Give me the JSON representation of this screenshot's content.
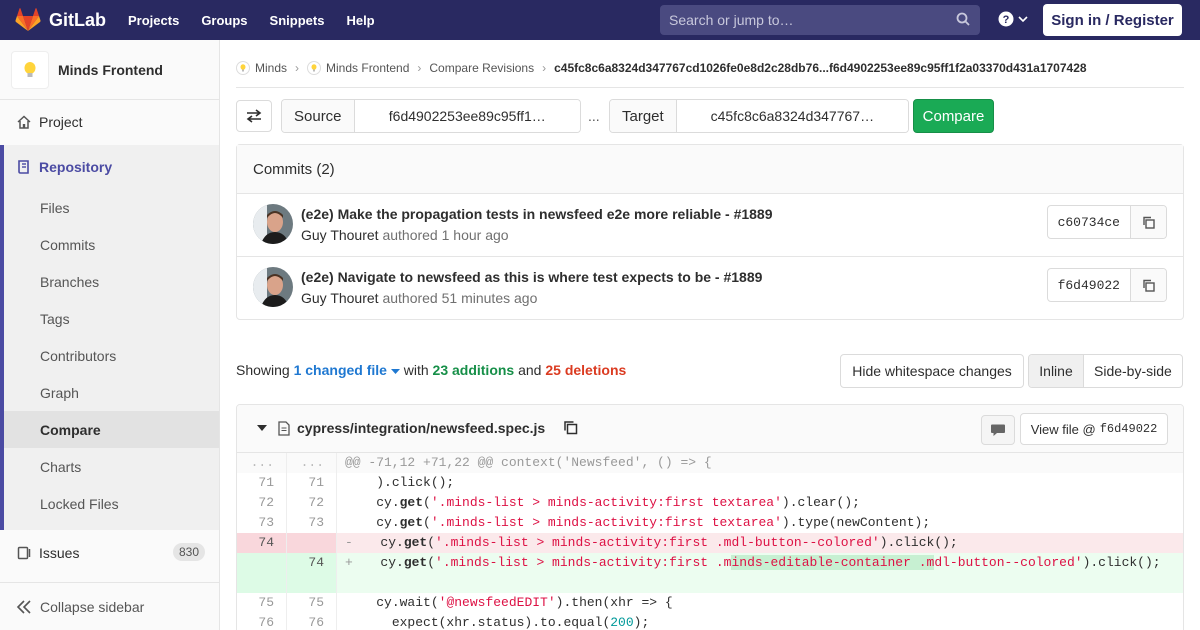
{
  "nav": {
    "brand": "GitLab",
    "links": [
      "Projects",
      "Groups",
      "Snippets",
      "Help"
    ],
    "search_placeholder": "Search or jump to…",
    "signin": "Sign in / Register"
  },
  "sidebar": {
    "project_name": "Minds Frontend",
    "project": "Project",
    "repository": "Repository",
    "repo_items": [
      "Files",
      "Commits",
      "Branches",
      "Tags",
      "Contributors",
      "Graph",
      "Compare",
      "Charts",
      "Locked Files"
    ],
    "active_item": "Compare",
    "issues": "Issues",
    "issues_count": "830",
    "collapse": "Collapse sidebar"
  },
  "breadcrumb": {
    "items": [
      "Minds",
      "Minds Frontend",
      "Compare Revisions"
    ],
    "current": "c45fc8c6a8324d347767cd1026fe0e8d2c28db76...f6d4902253ee89c95ff1f2a03370d431a1707428"
  },
  "compare": {
    "source_label": "Source",
    "source_value": "f6d4902253ee89c95ff1…",
    "dots": "...",
    "target_label": "Target",
    "target_value": "c45fc8c6a8324d347767…",
    "button": "Compare"
  },
  "commits": {
    "header": "Commits (2)",
    "items": [
      {
        "title": "(e2e) Make the propagation tests in newsfeed e2e more reliable - #1889",
        "author": "Guy Thouret",
        "authored": "authored",
        "time": "1 hour ago",
        "sha": "c60734ce"
      },
      {
        "title": "(e2e) Navigate to newsfeed as this is where test expects to be - #1889",
        "author": "Guy Thouret",
        "authored": "authored",
        "time": "51 minutes ago",
        "sha": "f6d49022"
      }
    ]
  },
  "stats": {
    "showing": "Showing",
    "files": "1 changed file",
    "with": "with",
    "additions": "23 additions",
    "and": "and",
    "deletions": "25 deletions",
    "whitespace": "Hide whitespace changes",
    "inline": "Inline",
    "side_by_side": "Side-by-side"
  },
  "file": {
    "path": "cypress/integration/newsfeed.spec.js",
    "view_file": "View file @",
    "view_sha": "f6d49022",
    "hunk_old": "...",
    "hunk_new": "...",
    "hunk": "@@ -71,12 +71,22 @@ context('Newsfeed', () => {",
    "lines": [
      {
        "old": "71",
        "new": "71"
      },
      {
        "old": "72",
        "new": "72"
      },
      {
        "old": "73",
        "new": "73"
      },
      {
        "old": "74",
        "new": ""
      },
      {
        "old": "",
        "new": "74"
      },
      {
        "old": "75",
        "new": "75"
      },
      {
        "old": "76",
        "new": "76"
      }
    ],
    "code": {
      "l71": "    ).click();",
      "l72_a": "    cy.",
      "l72_b": "get",
      "l72_c": "(",
      "l72_d": "'.minds-list > minds-activity:first textarea'",
      "l72_e": ").clear();",
      "l73_a": "    cy.",
      "l73_b": "get",
      "l73_c": "(",
      "l73_d": "'.minds-list > minds-activity:first textarea'",
      "l73_e": ").type(newContent);",
      "del_mark": "-",
      "del_a": "   cy.",
      "del_b": "get",
      "del_c": "(",
      "del_d": "'.minds-list > minds-activity:first .mdl-button--colored'",
      "del_e": ").click();",
      "add_mark": "+",
      "add_a": "   cy.",
      "add_b": "get",
      "add_c": "(",
      "add_d1": "'.minds-list > minds-activity:first .m",
      "add_hl": "inds-editable-container .m",
      "add_d2": "dl-button--colored'",
      "add_e": ").click();",
      "l75_a": "    cy.wait(",
      "l75_b": "'@newsfeedEDIT'",
      "l75_c": ").then(xhr => {",
      "l76_a": "      expect(xhr.status).to.equal(",
      "l76_b": "200",
      "l76_c": ");"
    }
  },
  "icons": {
    "logo": "gitlab-tanuki-icon",
    "search": "search-icon",
    "help": "question-icon",
    "swap": "swap-arrows-icon",
    "copy": "copy-icon",
    "comment": "comment-icon",
    "file": "file-icon"
  },
  "colors": {
    "nav_bg": "#292961",
    "accent": "#4b4ba3",
    "green": "#1aaa55",
    "red": "#db3b21",
    "link": "#1f78d1"
  }
}
